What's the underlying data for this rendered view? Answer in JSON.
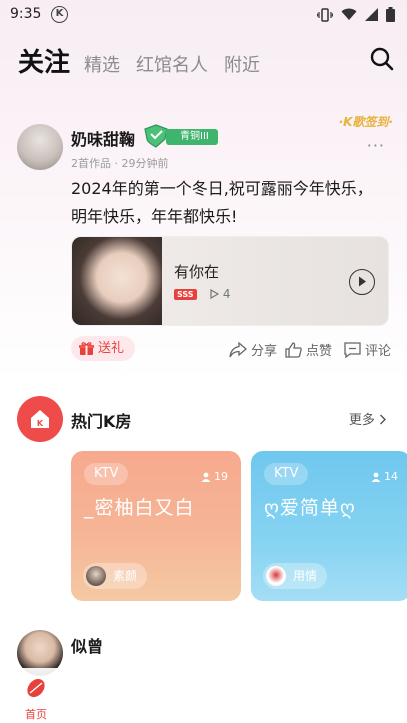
{
  "status_bar": {
    "time": "9:35",
    "k_badge": "K",
    "icons": [
      "vibrate-icon",
      "wifi-icon",
      "signal-icon",
      "battery-icon"
    ]
  },
  "tabs": [
    {
      "label": "关注",
      "active": true
    },
    {
      "label": "精选",
      "active": false
    },
    {
      "label": "红馆名人",
      "active": false
    },
    {
      "label": "附近",
      "active": false
    }
  ],
  "post": {
    "username": "奶味甜鞠",
    "level_badge": "青铜III",
    "meta": "2首作品 · 29分钟前",
    "sign_tag": "·K歌签到·",
    "more": "···",
    "text_line1": "2024年的第一个冬日,祝可露丽今年快乐，",
    "text_line2": "明年快乐，年年都快乐!",
    "song": {
      "title": "有你在",
      "quality": "SSS",
      "plays": "4"
    },
    "gift_label": "送礼",
    "actions": {
      "share": "分享",
      "like": "点赞",
      "comment": "评论"
    }
  },
  "hot_rooms": {
    "title": "热门K房",
    "more": "更多",
    "rooms": [
      {
        "tag": "KTV",
        "count": "19",
        "name": "_密柚白又白",
        "host": "素颜"
      },
      {
        "tag": "KTV",
        "count": "14",
        "name": "ღ爱简单ღ",
        "host": "用情"
      }
    ]
  },
  "post2": {
    "username": "似曾"
  },
  "bottom_nav": {
    "home_label": "首页"
  },
  "colors": {
    "accent": "#e8413b",
    "level_green": "#3fb46c",
    "room1": "#f7a98e",
    "room2": "#6fc7ee"
  }
}
